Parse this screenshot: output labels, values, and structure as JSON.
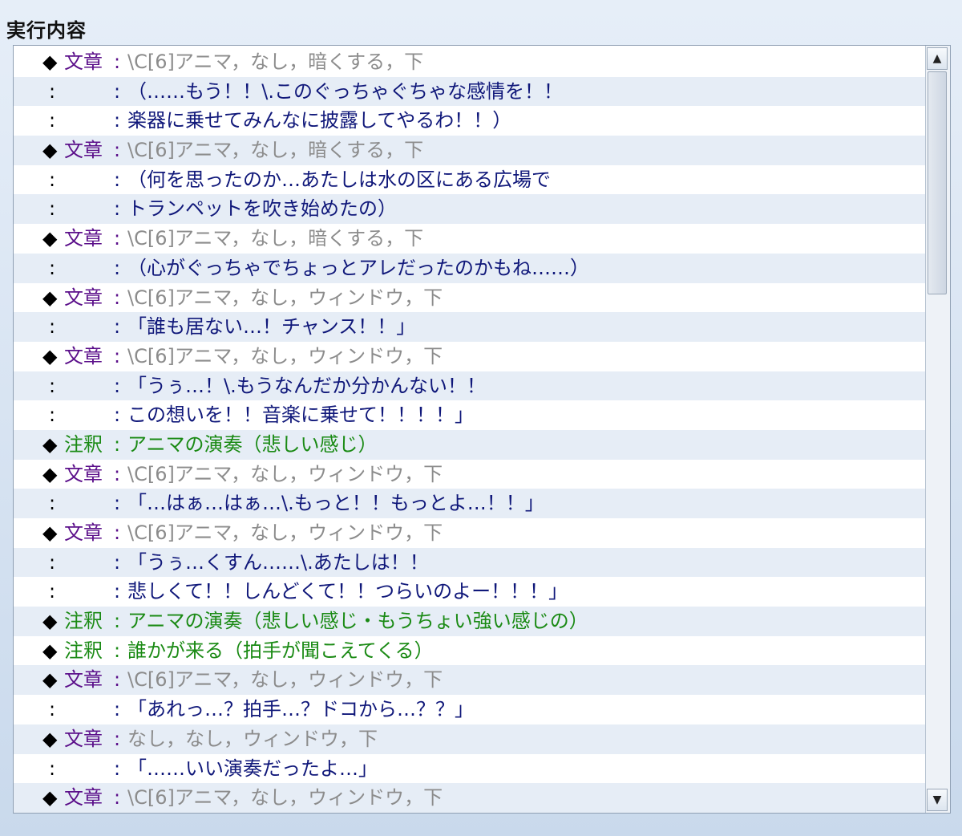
{
  "panel": {
    "title": "実行内容"
  },
  "scrollbar": {
    "up_icon": "▲",
    "down_icon": "▼"
  },
  "rows": [
    {
      "kind": "cmd",
      "marker": "◆",
      "cmd": "文章",
      "sep": ":",
      "text": "\\C[6]アニマ，なし，暗くする，下",
      "style": "gray"
    },
    {
      "kind": "cont",
      "colon": ":",
      "sep": ":",
      "text": "（……もう！！\\.このぐっちゃぐちゃな感情を！！",
      "style": "navy"
    },
    {
      "kind": "cont",
      "colon": ":",
      "sep": ":",
      "text": "楽器に乗せてみんなに披露してやるわ！！）",
      "style": "navy"
    },
    {
      "kind": "cmd",
      "marker": "◆",
      "cmd": "文章",
      "sep": ":",
      "text": "\\C[6]アニマ，なし，暗くする，下",
      "style": "gray"
    },
    {
      "kind": "cont",
      "colon": ":",
      "sep": ":",
      "text": "（何を思ったのか…あたしは水の区にある広場で",
      "style": "navy"
    },
    {
      "kind": "cont",
      "colon": ":",
      "sep": ":",
      "text": "トランペットを吹き始めたの）",
      "style": "navy"
    },
    {
      "kind": "cmd",
      "marker": "◆",
      "cmd": "文章",
      "sep": ":",
      "text": "\\C[6]アニマ，なし，暗くする，下",
      "style": "gray"
    },
    {
      "kind": "cont",
      "colon": ":",
      "sep": ":",
      "text": "（心がぐっちゃでちょっとアレだったのかもね……）",
      "style": "navy"
    },
    {
      "kind": "cmd",
      "marker": "◆",
      "cmd": "文章",
      "sep": ":",
      "text": "\\C[6]アニマ，なし，ウィンドウ，下",
      "style": "gray"
    },
    {
      "kind": "cont",
      "colon": ":",
      "sep": ":",
      "text": "「誰も居ない…！チャンス！！」",
      "style": "navy"
    },
    {
      "kind": "cmd",
      "marker": "◆",
      "cmd": "文章",
      "sep": ":",
      "text": "\\C[6]アニマ，なし，ウィンドウ，下",
      "style": "gray"
    },
    {
      "kind": "cont",
      "colon": ":",
      "sep": ":",
      "text": "「うぅ…！\\.もうなんだか分かんない！！",
      "style": "navy"
    },
    {
      "kind": "cont",
      "colon": ":",
      "sep": ":",
      "text": "この想いを！！音楽に乗せて！！！！」",
      "style": "navy"
    },
    {
      "kind": "note",
      "marker": "◆",
      "cmd": "注釈",
      "sep": ":",
      "text": "アニマの演奏（悲しい感じ）",
      "style": "green"
    },
    {
      "kind": "cmd",
      "marker": "◆",
      "cmd": "文章",
      "sep": ":",
      "text": "\\C[6]アニマ，なし，ウィンドウ，下",
      "style": "gray"
    },
    {
      "kind": "cont",
      "colon": ":",
      "sep": ":",
      "text": "「…はぁ…はぁ…\\.もっと！！もっとよ…！！」",
      "style": "navy"
    },
    {
      "kind": "cmd",
      "marker": "◆",
      "cmd": "文章",
      "sep": ":",
      "text": "\\C[6]アニマ，なし，ウィンドウ，下",
      "style": "gray"
    },
    {
      "kind": "cont",
      "colon": ":",
      "sep": ":",
      "text": "「うぅ…くすん……\\.あたしは！！",
      "style": "navy"
    },
    {
      "kind": "cont",
      "colon": ":",
      "sep": ":",
      "text": "悲しくて！！しんどくて！！つらいのよー！！！」",
      "style": "navy"
    },
    {
      "kind": "note",
      "marker": "◆",
      "cmd": "注釈",
      "sep": ":",
      "text": "アニマの演奏（悲しい感じ・もうちょい強い感じの）",
      "style": "green"
    },
    {
      "kind": "note",
      "marker": "◆",
      "cmd": "注釈",
      "sep": ":",
      "text": "誰かが来る（拍手が聞こえてくる）",
      "style": "green"
    },
    {
      "kind": "cmd",
      "marker": "◆",
      "cmd": "文章",
      "sep": ":",
      "text": "\\C[6]アニマ，なし，ウィンドウ，下",
      "style": "gray"
    },
    {
      "kind": "cont",
      "colon": ":",
      "sep": ":",
      "text": "「あれっ…？拍手…？ドコから…？？」",
      "style": "navy"
    },
    {
      "kind": "cmd",
      "marker": "◆",
      "cmd": "文章",
      "sep": ":",
      "text": "なし，なし，ウィンドウ，下",
      "style": "gray"
    },
    {
      "kind": "cont",
      "colon": ":",
      "sep": ":",
      "text": "「……いい演奏だったよ…」",
      "style": "navy"
    },
    {
      "kind": "cmd",
      "marker": "◆",
      "cmd": "文章",
      "sep": ":",
      "text": "\\C[6]アニマ，なし，ウィンドウ，下",
      "style": "gray"
    }
  ]
}
